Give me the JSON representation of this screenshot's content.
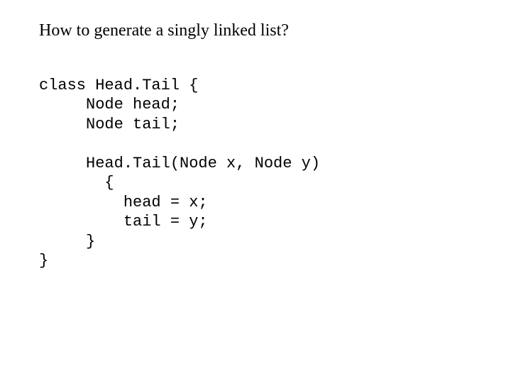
{
  "heading": "How to generate a singly linked list?",
  "code": {
    "l1": "class Head.Tail {",
    "l2": "     Node head;",
    "l3": "     Node tail;",
    "l4": "",
    "l5": "     Head.Tail(Node x, Node y)",
    "l6": "       {",
    "l7": "         head = x;",
    "l8": "         tail = y;",
    "l9": "     }",
    "l10": "}"
  }
}
